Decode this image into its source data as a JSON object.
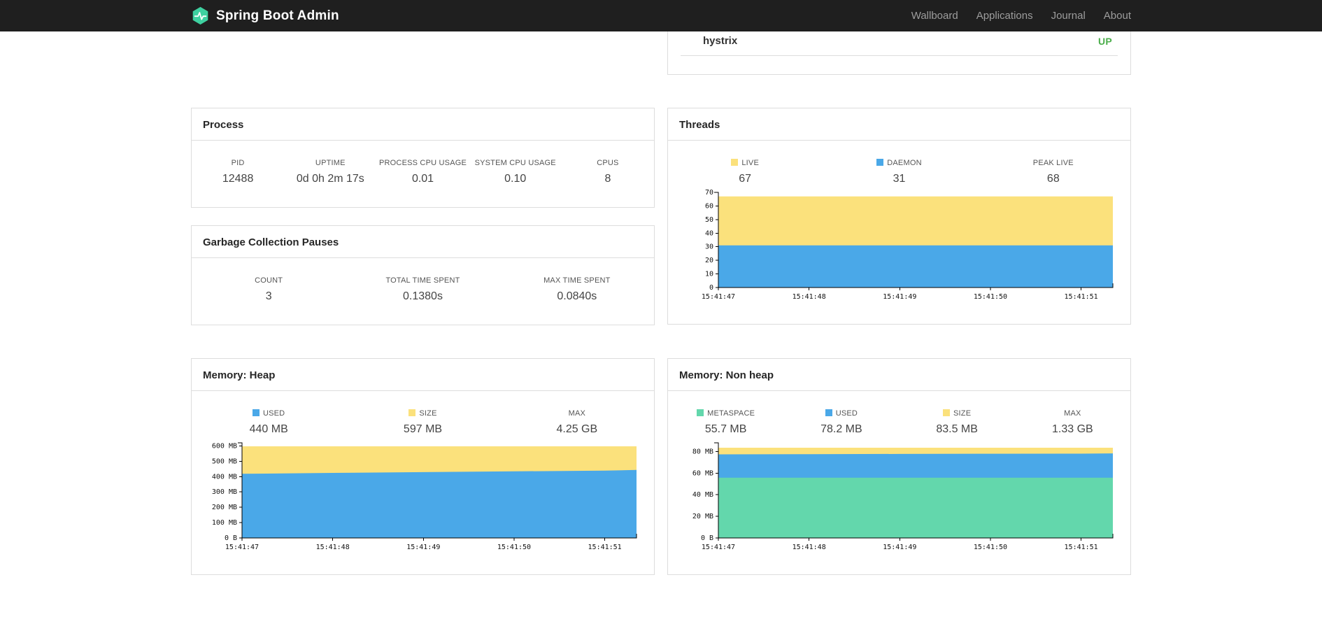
{
  "navbar": {
    "brand": "Spring Boot Admin",
    "items": [
      {
        "label": "Wallboard"
      },
      {
        "label": "Applications"
      },
      {
        "label": "Journal"
      },
      {
        "label": "About"
      }
    ]
  },
  "colors": {
    "up_green": "#4cae4c",
    "series_blue": "#4aa8e8",
    "series_yellow": "#fbe17c",
    "series_green": "#63d7ac",
    "brand_green": "#3ed0a0",
    "navbar_bg": "#1f1f1f"
  },
  "health": {
    "service": "hystrix",
    "status": "UP"
  },
  "process": {
    "title": "Process",
    "metrics": [
      {
        "label": "PID",
        "value": "12488"
      },
      {
        "label": "UPTIME",
        "value": "0d 0h 2m 17s"
      },
      {
        "label": "PROCESS CPU USAGE",
        "value": "0.01"
      },
      {
        "label": "SYSTEM CPU USAGE",
        "value": "0.10"
      },
      {
        "label": "CPUS",
        "value": "8"
      }
    ]
  },
  "gc": {
    "title": "Garbage Collection Pauses",
    "metrics": [
      {
        "label": "COUNT",
        "value": "3"
      },
      {
        "label": "TOTAL TIME SPENT",
        "value": "0.1380s"
      },
      {
        "label": "MAX TIME SPENT",
        "value": "0.0840s"
      }
    ]
  },
  "threads": {
    "title": "Threads",
    "metrics": [
      {
        "label": "LIVE",
        "value": "67",
        "color": "#fbe17c"
      },
      {
        "label": "DAEMON",
        "value": "31",
        "color": "#4aa8e8"
      },
      {
        "label": "PEAK LIVE",
        "value": "68"
      }
    ]
  },
  "heap": {
    "title": "Memory: Heap",
    "metrics": [
      {
        "label": "USED",
        "value": "440 MB",
        "color": "#4aa8e8"
      },
      {
        "label": "SIZE",
        "value": "597 MB",
        "color": "#fbe17c"
      },
      {
        "label": "MAX",
        "value": "4.25 GB"
      }
    ]
  },
  "nonheap": {
    "title": "Memory: Non heap",
    "metrics": [
      {
        "label": "METASPACE",
        "value": "55.7 MB",
        "color": "#63d7ac"
      },
      {
        "label": "USED",
        "value": "78.2 MB",
        "color": "#4aa8e8"
      },
      {
        "label": "SIZE",
        "value": "83.5 MB",
        "color": "#fbe17c"
      },
      {
        "label": "MAX",
        "value": "1.33 GB"
      }
    ]
  },
  "chart_data": [
    {
      "type": "area",
      "title": "Threads",
      "x": [
        0,
        1,
        2,
        3,
        4,
        4.35
      ],
      "xmax": 4.35,
      "ymax": 70,
      "yticks": [
        {
          "v": 0,
          "label": "0"
        },
        {
          "v": 10,
          "label": "10"
        },
        {
          "v": 20,
          "label": "20"
        },
        {
          "v": 30,
          "label": "30"
        },
        {
          "v": 40,
          "label": "40"
        },
        {
          "v": 50,
          "label": "50"
        },
        {
          "v": 60,
          "label": "60"
        },
        {
          "v": 70,
          "label": "70"
        }
      ],
      "xticks": [
        {
          "v": 0,
          "label": "15:41:47"
        },
        {
          "v": 1,
          "label": "15:41:48"
        },
        {
          "v": 2,
          "label": "15:41:49"
        },
        {
          "v": 3,
          "label": "15:41:50"
        },
        {
          "v": 4,
          "label": "15:41:51"
        }
      ],
      "series": [
        {
          "name": "DAEMON",
          "color": "#4aa8e8",
          "values": [
            31,
            31,
            31,
            31,
            31,
            31
          ]
        },
        {
          "name": "LIVE",
          "color": "#fbe17c",
          "values": [
            67,
            67,
            67,
            67,
            67,
            67
          ]
        }
      ]
    },
    {
      "type": "area",
      "title": "Memory: Heap",
      "x": [
        0,
        1,
        2,
        3,
        4,
        4.35
      ],
      "xmax": 4.35,
      "ymax": 620,
      "yticks": [
        {
          "v": 0,
          "label": "0 B"
        },
        {
          "v": 100,
          "label": "100 MB"
        },
        {
          "v": 200,
          "label": "200 MB"
        },
        {
          "v": 300,
          "label": "300 MB"
        },
        {
          "v": 400,
          "label": "400 MB"
        },
        {
          "v": 500,
          "label": "500 MB"
        },
        {
          "v": 600,
          "label": "600 MB"
        }
      ],
      "xticks": [
        {
          "v": 0,
          "label": "15:41:47"
        },
        {
          "v": 1,
          "label": "15:41:48"
        },
        {
          "v": 2,
          "label": "15:41:49"
        },
        {
          "v": 3,
          "label": "15:41:50"
        },
        {
          "v": 4,
          "label": "15:41:51"
        }
      ],
      "series": [
        {
          "name": "USED",
          "color": "#4aa8e8",
          "values": [
            418,
            424,
            429,
            434,
            439,
            443
          ]
        },
        {
          "name": "SIZE",
          "color": "#fbe17c",
          "values": [
            597,
            597,
            597,
            597,
            597,
            597
          ]
        }
      ]
    },
    {
      "type": "area",
      "title": "Memory: Non heap",
      "x": [
        0,
        1,
        2,
        3,
        4,
        4.35
      ],
      "xmax": 4.35,
      "ymax": 88,
      "yticks": [
        {
          "v": 0,
          "label": "0 B"
        },
        {
          "v": 20,
          "label": "20 MB"
        },
        {
          "v": 40,
          "label": "40 MB"
        },
        {
          "v": 60,
          "label": "60 MB"
        },
        {
          "v": 80,
          "label": "80 MB"
        }
      ],
      "xticks": [
        {
          "v": 0,
          "label": "15:41:47"
        },
        {
          "v": 1,
          "label": "15:41:48"
        },
        {
          "v": 2,
          "label": "15:41:49"
        },
        {
          "v": 3,
          "label": "15:41:50"
        },
        {
          "v": 4,
          "label": "15:41:51"
        }
      ],
      "series": [
        {
          "name": "METASPACE",
          "color": "#63d7ac",
          "values": [
            55.7,
            55.7,
            55.7,
            55.7,
            55.7,
            55.7
          ]
        },
        {
          "name": "USED",
          "color": "#4aa8e8",
          "values": [
            77.3,
            77.5,
            77.7,
            77.9,
            78.0,
            78.2
          ]
        },
        {
          "name": "SIZE",
          "color": "#fbe17c",
          "values": [
            83.5,
            83.5,
            83.5,
            83.5,
            83.5,
            83.5
          ]
        }
      ]
    }
  ]
}
